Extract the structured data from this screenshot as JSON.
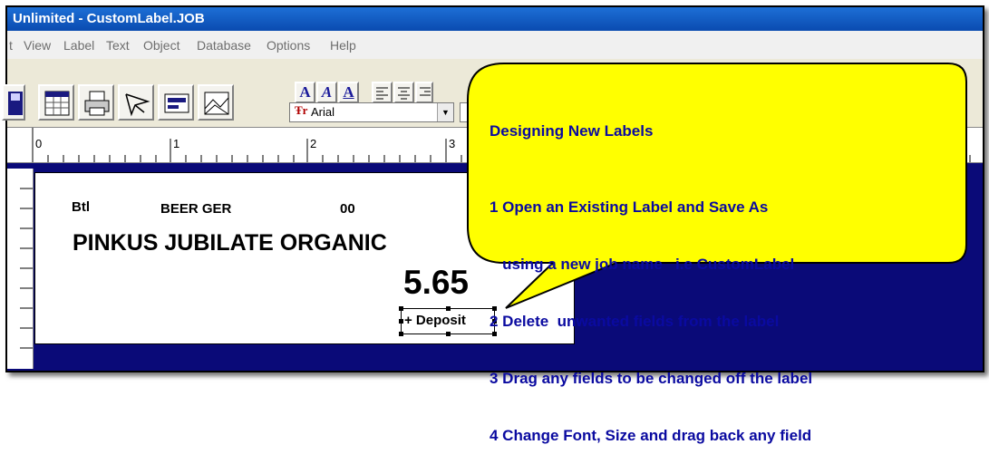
{
  "window": {
    "title": "Unlimited - CustomLabel.JOB"
  },
  "menu": {
    "items": [
      "t",
      "View",
      "Label",
      "Text",
      "Object",
      "Database",
      "Options",
      "Help"
    ]
  },
  "toolbar": {
    "buttons": [
      "save-icon",
      "calendar-icon",
      "print-icon",
      "pointer-icon",
      "label-icon",
      "image-icon"
    ],
    "font_style_buttons": [
      "A",
      "A",
      "A"
    ],
    "font_name": "Arial",
    "font_icon_glyph": "Ŧr"
  },
  "ruler": {
    "marks": [
      "0",
      "1",
      "2",
      "3"
    ]
  },
  "label": {
    "unit": "Btl",
    "category": "BEER GER",
    "code": "00",
    "product_name": "PINKUS JUBILATE ORGANIC",
    "price": "5.65",
    "deposit": "+ Deposit"
  },
  "callout": {
    "title": "Designing New Labels",
    "lines": [
      "1 Open an Existing Label and Save As",
      "   using a new job name   i.e CustomLabel",
      "2 Delete  unwanted fields from the label",
      "3 Drag any fields to be changed off the label",
      "4 Change Font, Size and drag back any field"
    ],
    "fill": "#ffff00",
    "text_color": "#0a0aa0"
  },
  "colors": {
    "canvas": "#0a0a78",
    "titlebar": "#1d6fd6",
    "toolbar": "#ece9d8"
  }
}
